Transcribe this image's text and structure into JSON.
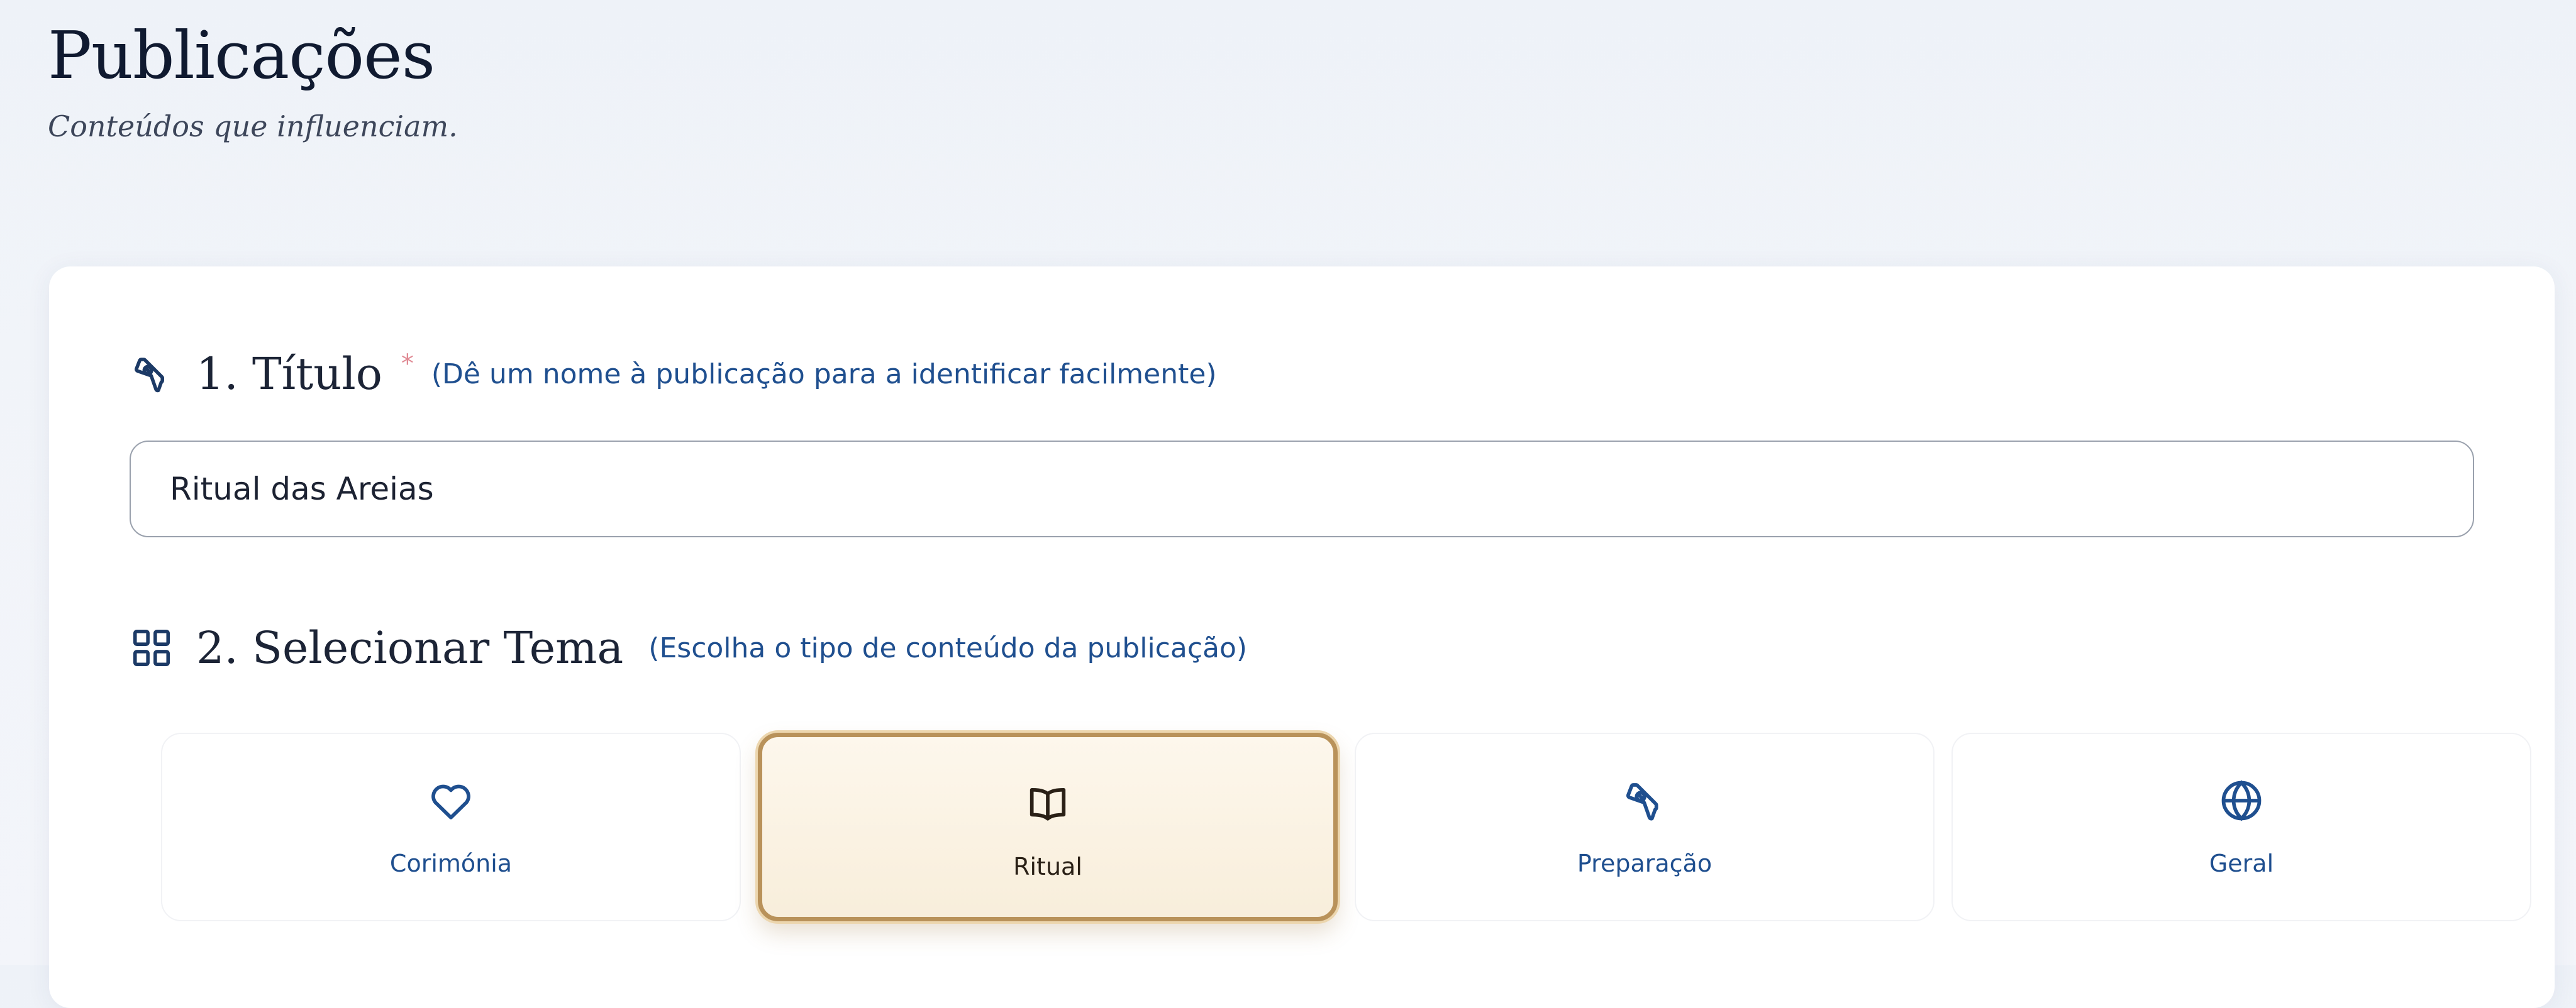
{
  "header": {
    "title": "Publicações",
    "subtitle": "Conteúdos que influenciam."
  },
  "form": {
    "title_section": {
      "label": "1. Título",
      "required_mark": "*",
      "hint": "(Dê um nome à publicação para a identificar facilmente)",
      "icon": "pen-nib-icon",
      "value": "Ritual das Areias"
    },
    "theme_section": {
      "label": "2. Selecionar Tema",
      "hint": "(Escolha o tipo de conteúdo da publicação)",
      "icon": "grid-icon",
      "selected": "Ritual",
      "options": [
        {
          "label": "Corimónia",
          "icon": "heart-icon"
        },
        {
          "label": "Ritual",
          "icon": "open-book-icon"
        },
        {
          "label": "Preparação",
          "icon": "pen-nib-icon"
        },
        {
          "label": "Geral",
          "icon": "globe-icon"
        }
      ]
    }
  },
  "colors": {
    "accent_blue": "#1f4f8f",
    "title_dark": "#101a30",
    "selected_border": "#b9925a",
    "selected_bg": "#f8eedb",
    "required": "#e08a94"
  }
}
